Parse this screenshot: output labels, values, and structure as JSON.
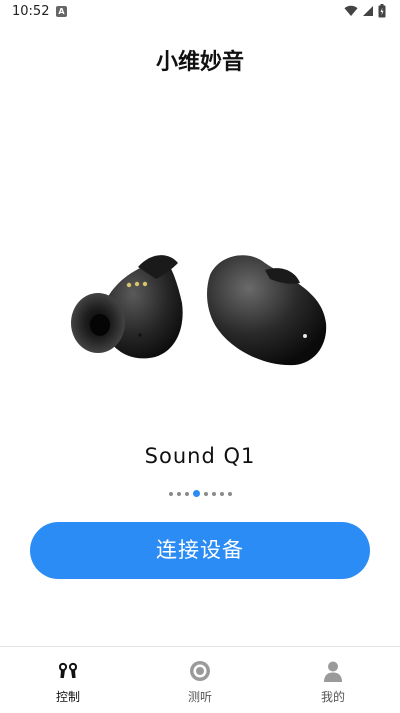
{
  "status_bar": {
    "time": "10:52",
    "app_icon_letter": "A",
    "icons": [
      "wifi-icon",
      "signal-icon",
      "battery-icon"
    ]
  },
  "header": {
    "title": "小维妙音"
  },
  "carousel": {
    "product_name": "Sound  Q1",
    "page_count": 7,
    "active_index": 3
  },
  "actions": {
    "connect_label": "连接设备"
  },
  "bottom_nav": {
    "items": [
      {
        "label": "控制",
        "icon": "earbuds-icon",
        "active": true
      },
      {
        "label": "测听",
        "icon": "hearing-test-icon",
        "active": false
      },
      {
        "label": "我的",
        "icon": "profile-icon",
        "active": false
      }
    ]
  },
  "colors": {
    "accent": "#2a8cf4",
    "inactive": "#9a9a9a"
  }
}
